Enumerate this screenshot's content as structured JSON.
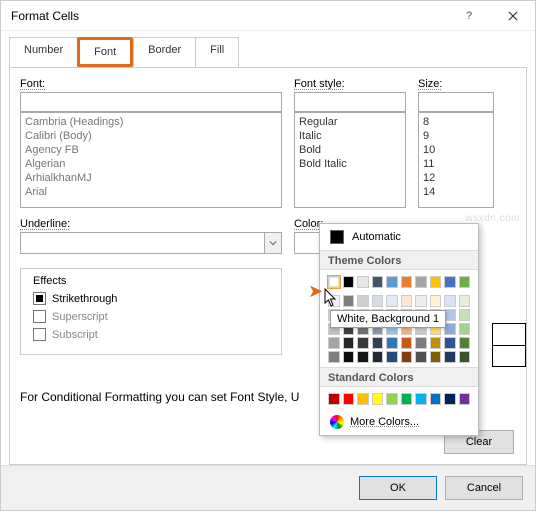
{
  "window": {
    "title": "Format Cells"
  },
  "tabs": {
    "number": "Number",
    "font": "Font",
    "border": "Border",
    "fill": "Fill",
    "active": "font"
  },
  "labels": {
    "font": "Font:",
    "fontstyle": "Font style:",
    "size": "Size:",
    "underline": "Underline:",
    "color": "Color:",
    "effects": "Effects"
  },
  "font_list": [
    "Cambria (Headings)",
    "Calibri (Body)",
    "Agency FB",
    "Algerian",
    "ArhialkhanMJ",
    "Arial"
  ],
  "fontstyle_list": [
    "Regular",
    "Italic",
    "Bold",
    "Bold Italic"
  ],
  "size_list": [
    "8",
    "9",
    "10",
    "11",
    "12",
    "14"
  ],
  "underline_value": "",
  "color_value": "Automatic",
  "effects": {
    "strikethrough": {
      "label": "Strikethrough",
      "checked": true
    },
    "superscript": {
      "label": "Superscript",
      "checked": false
    },
    "subscript": {
      "label": "Subscript",
      "checked": false
    }
  },
  "cond_text": "For Conditional Formatting you can set Font Style, U",
  "buttons": {
    "clear": "Clear",
    "ok": "OK",
    "cancel": "Cancel"
  },
  "color_panel": {
    "automatic": "Automatic",
    "theme_header": "Theme Colors",
    "standard_header": "Standard Colors",
    "more": "More Colors...",
    "tooltip": "White, Background 1",
    "theme_row1": [
      "#ffffff",
      "#000000",
      "#e7e6e6",
      "#44546a",
      "#5b9bd5",
      "#ed7d31",
      "#a5a5a5",
      "#ffc000",
      "#4472c4",
      "#70ad47"
    ],
    "theme_shades": [
      [
        "#f2f2f2",
        "#7f7f7f",
        "#d0cece",
        "#d6dce4",
        "#deebf6",
        "#fbe5d5",
        "#ededed",
        "#fff2cc",
        "#d9e2f3",
        "#e2efd9"
      ],
      [
        "#d8d8d8",
        "#595959",
        "#aeabab",
        "#adb9ca",
        "#bdd7ee",
        "#f7cbac",
        "#dbdbdb",
        "#fee599",
        "#b4c6e7",
        "#c5e0b3"
      ],
      [
        "#bfbfbf",
        "#3f3f3f",
        "#757070",
        "#8496b0",
        "#9cc3e5",
        "#f4b183",
        "#c9c9c9",
        "#ffd965",
        "#8eaadb",
        "#a8d08d"
      ],
      [
        "#a5a5a5",
        "#262626",
        "#3a3838",
        "#323f4f",
        "#2e75b5",
        "#c55a11",
        "#7b7b7b",
        "#bf9000",
        "#2f5496",
        "#538135"
      ],
      [
        "#7f7f7f",
        "#0c0c0c",
        "#171616",
        "#222a35",
        "#1e4e79",
        "#833c0b",
        "#525252",
        "#7f6000",
        "#1f3864",
        "#375623"
      ]
    ],
    "standard": [
      "#c00000",
      "#ff0000",
      "#ffc000",
      "#ffff00",
      "#92d050",
      "#00b050",
      "#00b0f0",
      "#0070c0",
      "#002060",
      "#7030a0"
    ]
  },
  "watermark": "wsxdn.com"
}
